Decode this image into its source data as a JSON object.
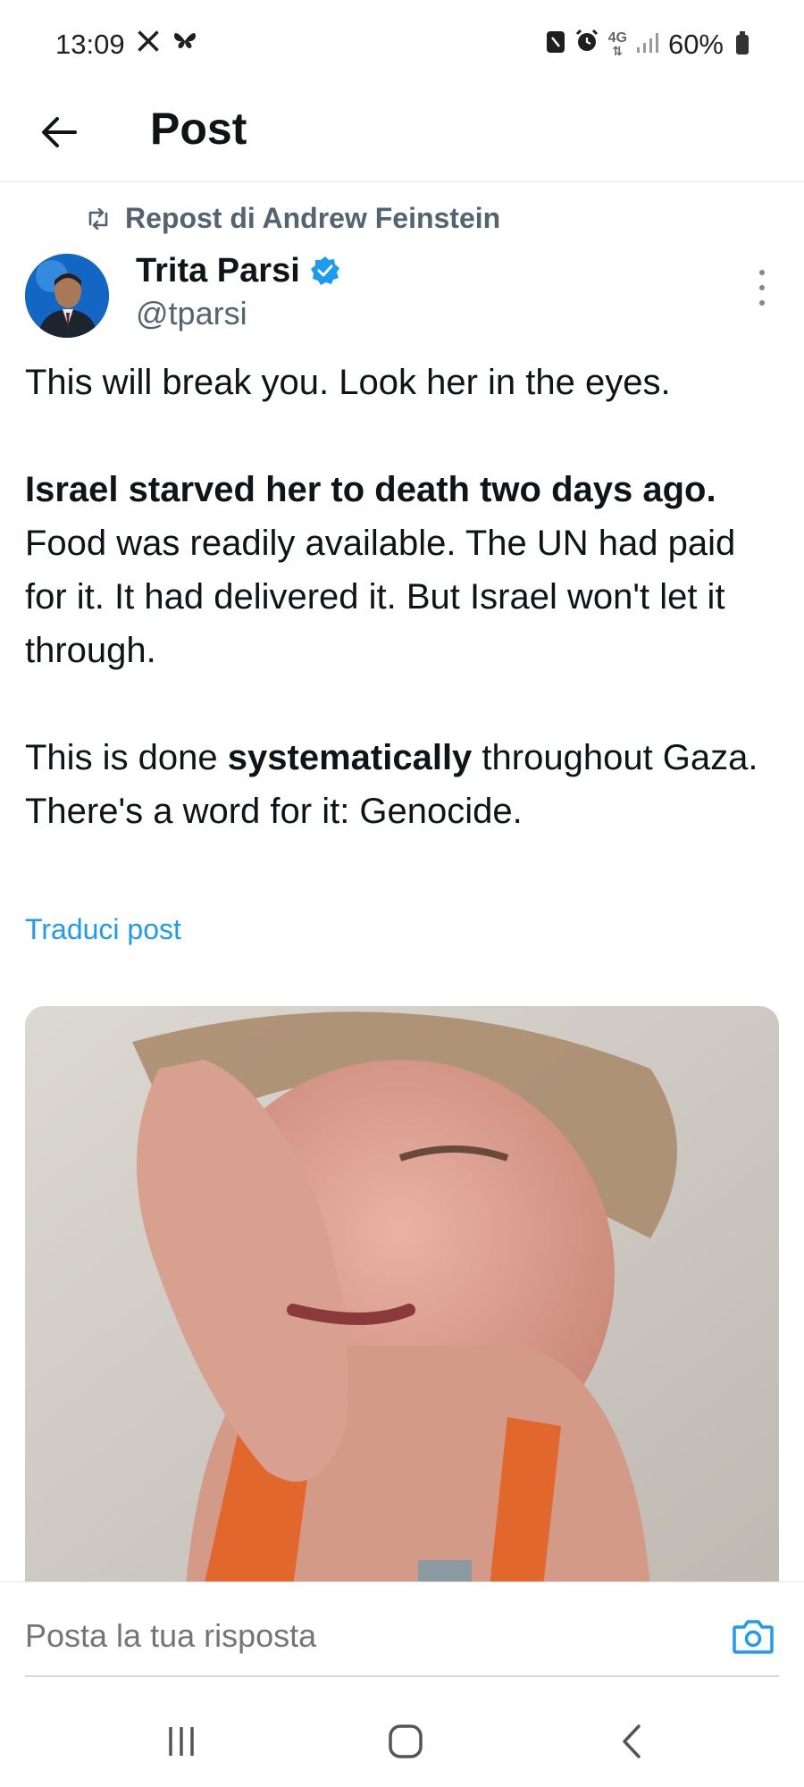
{
  "status_bar": {
    "time": "13:09",
    "network": "4G",
    "battery": "60%",
    "icons": [
      "x-logo-icon",
      "bluesky-icon",
      "nfc-icon",
      "alarm-icon",
      "network-4g-icon",
      "signal-icon",
      "battery-icon"
    ]
  },
  "header": {
    "title": "Post",
    "back_icon": "arrow-left-icon"
  },
  "post": {
    "repost_label": "Repost di Andrew Feinstein",
    "author_name": "Trita Parsi",
    "author_handle": "@tparsi",
    "verified": true,
    "text": {
      "p1": "This will break you. Look her in the eyes.",
      "p2_bold": "Israel starved her to death two days ago.",
      "p2_rest": " Food was readily available. The UN had paid for it. It had delivered it. But Israel won't let it through.",
      "p3_start": "This is done ",
      "p3_bold": "systematically",
      "p3_end": " throughout Gaza. There's a word for it: Genocide."
    },
    "translate_link": "Traduci post"
  },
  "reply": {
    "placeholder": "Posta la tua risposta"
  },
  "colors": {
    "accent": "#1d9bf0",
    "secondary_text": "#536471",
    "primary_text": "#0f1419"
  }
}
